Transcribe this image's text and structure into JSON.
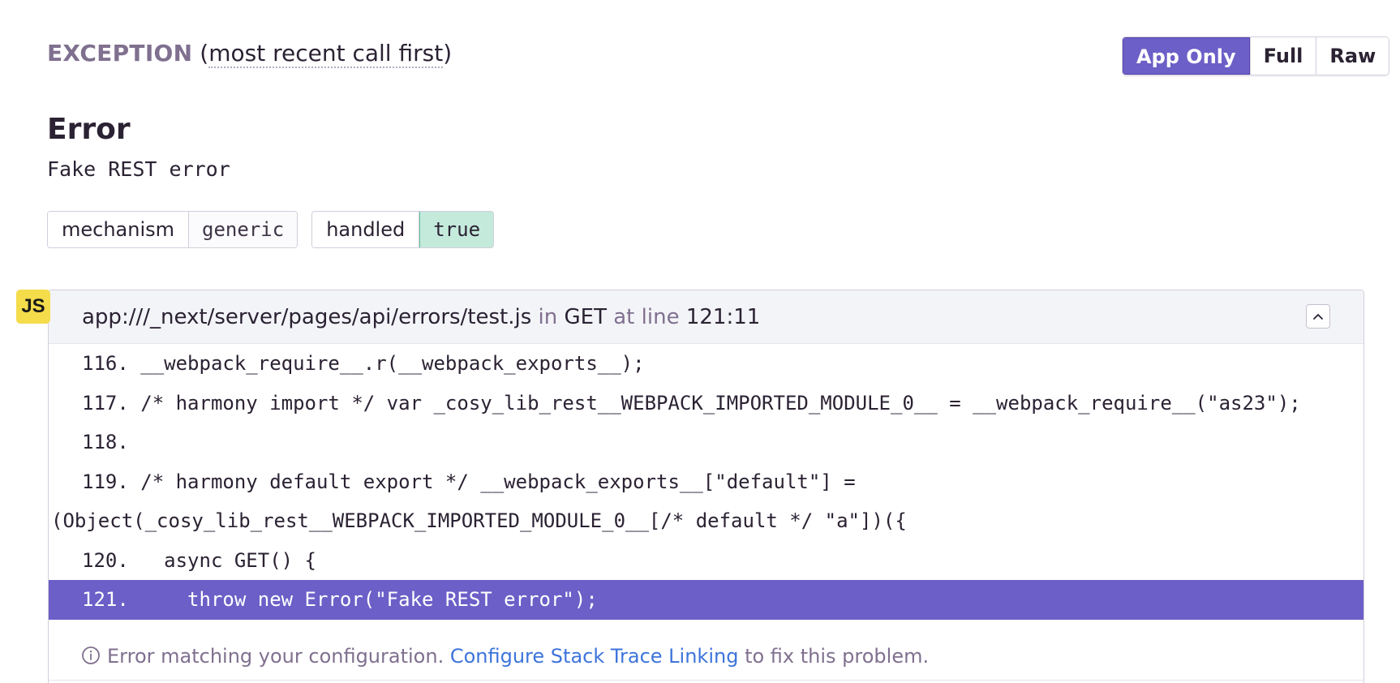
{
  "header": {
    "label": "EXCEPTION",
    "paren_open": "(",
    "order": "most recent call first",
    "paren_close": ")"
  },
  "view_toggle": {
    "options": [
      "App Only",
      "Full",
      "Raw"
    ],
    "selected": "App Only"
  },
  "exception": {
    "type": "Error",
    "value": "Fake REST error"
  },
  "mechanism": [
    {
      "key": "mechanism",
      "value": "generic"
    },
    {
      "key": "handled",
      "value": "true"
    }
  ],
  "frame": {
    "badge": "JS",
    "file": "app:///_next/server/pages/api/errors/test.js",
    "in_label": "in",
    "function": "GET",
    "at_line_label": "at line",
    "line_col": "121:11",
    "lines": [
      "116. __webpack_require__.r(__webpack_exports__);",
      "117. /* harmony import */ var _cosy_lib_rest__WEBPACK_IMPORTED_MODULE_0__ = __webpack_require__(\"as23\");",
      "118.",
      "119. /* harmony default export */ __webpack_exports__[\"default\"] =",
      "(Object(_cosy_lib_rest__WEBPACK_IMPORTED_MODULE_0__[/* default */ \"a\"])({",
      "120.   async GET() {",
      "121.     throw new Error(\"Fake REST error\");"
    ],
    "notice_text": "Error matching your configuration.",
    "notice_link": "Configure Stack Trace Linking",
    "notice_suffix": "to fix this problem."
  },
  "colors": {
    "accent": "#6c5fc7",
    "handled_true_bg": "#c4eadb",
    "js_badge": "#f4dc4b",
    "link": "#3d74db"
  }
}
